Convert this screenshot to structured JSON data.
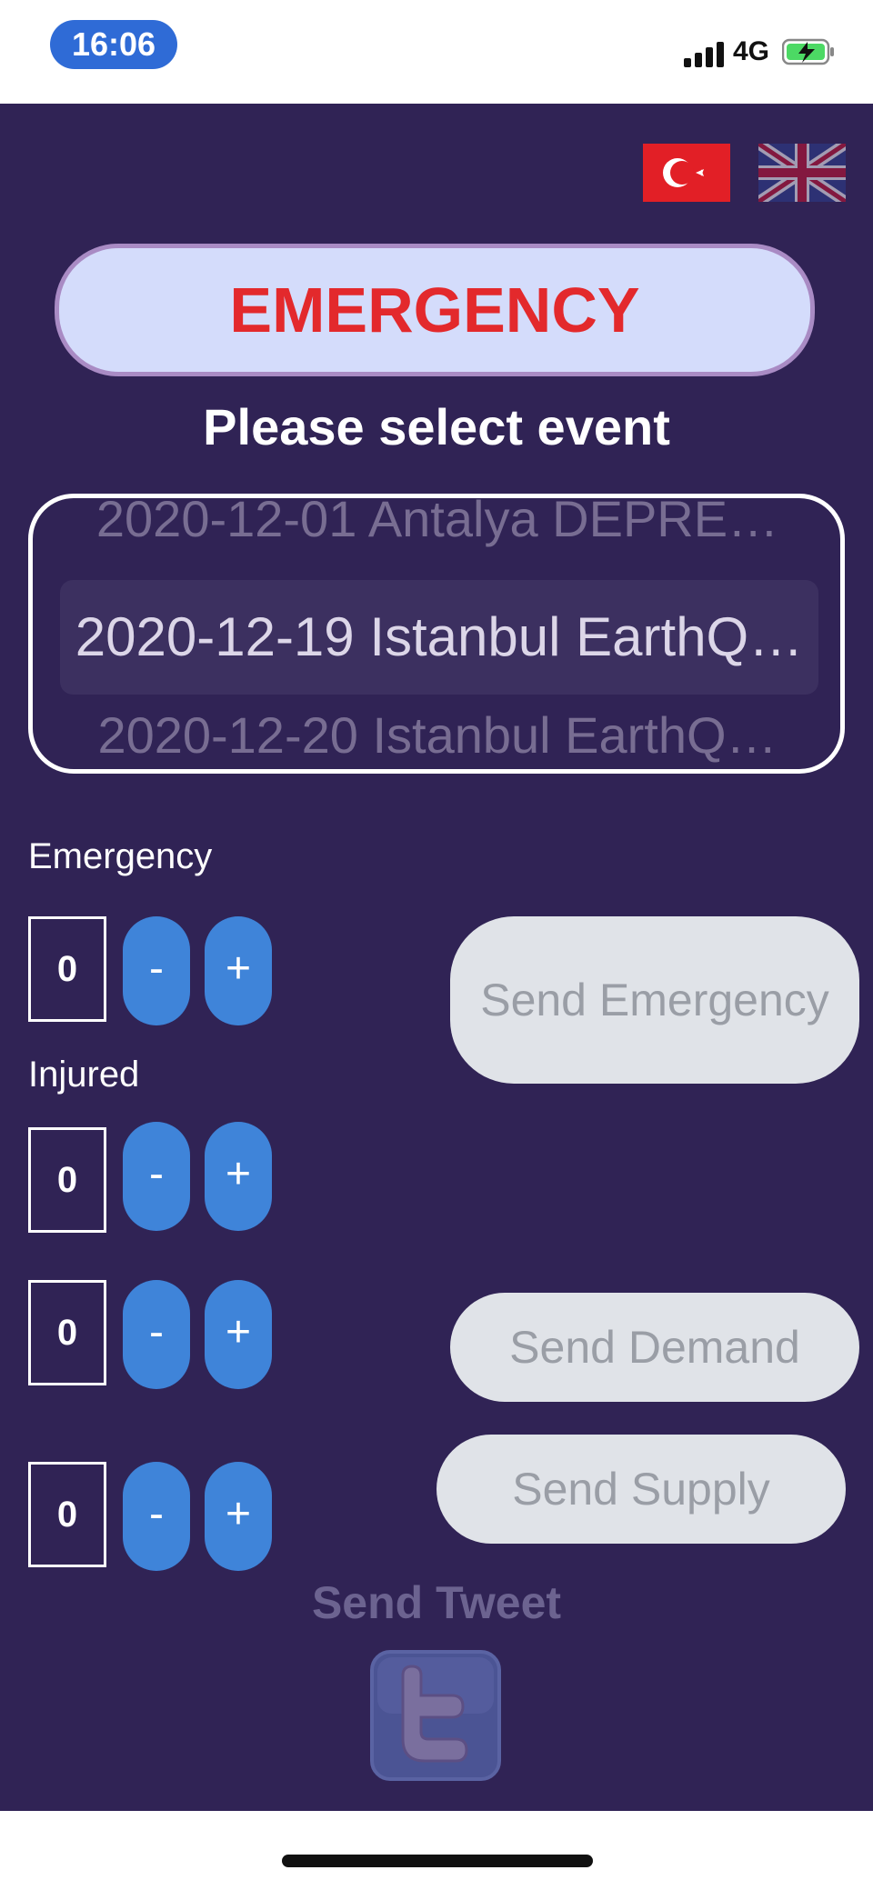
{
  "status_bar": {
    "time": "16:06",
    "network": "4G"
  },
  "languages": {
    "turkish": "tr-flag-icon",
    "english": "uk-flag-icon"
  },
  "header": {
    "emergency": "EMERGENCY",
    "select_prompt": "Please select event"
  },
  "event_picker": {
    "previous": "2020-12-01 Antalya DEPRE…",
    "selected": "2020-12-19 Istanbul EarthQ…",
    "next": "2020-12-20 Istanbul EarthQ…"
  },
  "counters": {
    "emergency": {
      "label": "Emergency",
      "value": "0",
      "minus": "-",
      "plus": "+"
    },
    "injured": {
      "label": "Injured",
      "value": "0",
      "minus": "-",
      "plus": "+"
    },
    "demand": {
      "value": "0",
      "minus": "-",
      "plus": "+"
    },
    "supply": {
      "value": "0",
      "minus": "-",
      "plus": "+"
    }
  },
  "actions": {
    "send_emergency": "Send Emergency",
    "send_demand": "Send Demand",
    "send_supply": "Send Supply",
    "send_tweet": "Send Tweet"
  },
  "colors": {
    "background": "#302355",
    "accent_red": "#e3292c",
    "button_blue": "#3f84d9",
    "disabled_button": "#e0e3e8"
  }
}
